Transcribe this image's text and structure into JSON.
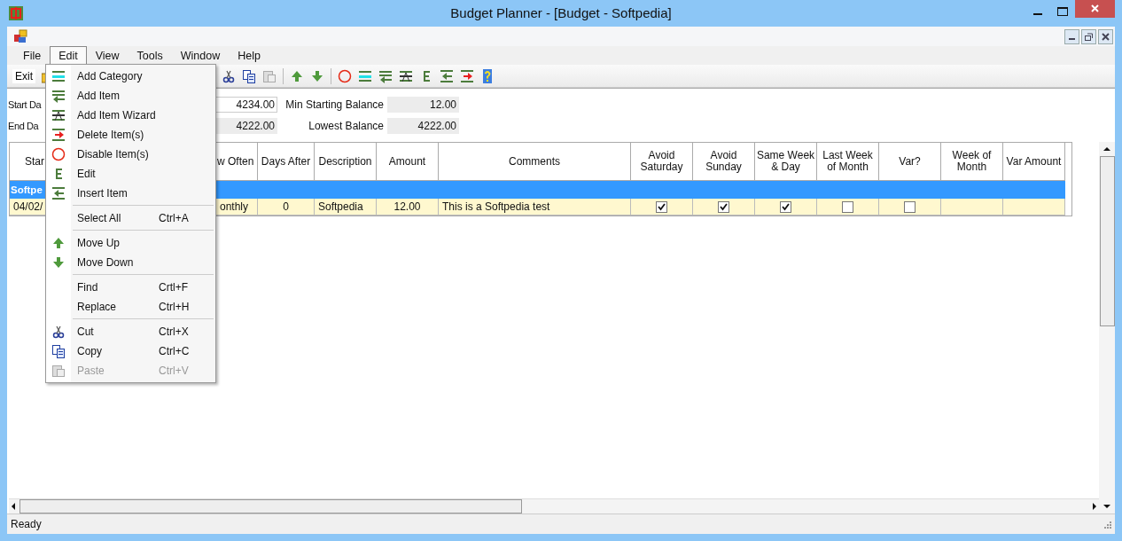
{
  "window": {
    "title": "Budget Planner - [Budget - Softpedia]"
  },
  "menubar": [
    {
      "label": "File",
      "selected": false
    },
    {
      "label": "Edit",
      "selected": true
    },
    {
      "label": "View",
      "selected": false
    },
    {
      "label": "Tools",
      "selected": false
    },
    {
      "label": "Window",
      "selected": false
    },
    {
      "label": "Help",
      "selected": false
    }
  ],
  "toolbar": {
    "exit": "Exit"
  },
  "summary": [
    {
      "label": "Start Da",
      "value": "4234.00",
      "editable": true,
      "label2": "Min Starting Balance",
      "value2": "12.00"
    },
    {
      "label": "End Da",
      "value": "4222.00",
      "editable": false,
      "label2": "Lowest Balance",
      "value2": "4222.00"
    }
  ],
  "grid": {
    "columns": [
      "Star",
      "w Often",
      "Days After",
      "Description",
      "Amount",
      "Comments",
      "Avoid Saturday",
      "Avoid Sunday",
      "Same Week & Day",
      "Last Week of Month",
      "Var?",
      "Week of Month",
      "Var Amount"
    ],
    "category": "Softpe",
    "rows": [
      {
        "cells": [
          {
            "kind": "text",
            "text": "04/02/"
          },
          {
            "kind": "text",
            "text": "onthly"
          },
          {
            "kind": "text",
            "text": "0"
          },
          {
            "kind": "text",
            "text": "Softpedia"
          },
          {
            "kind": "text",
            "text": "12.00"
          },
          {
            "kind": "text",
            "text": "This is a Softpedia test"
          },
          {
            "kind": "check",
            "checked": true
          },
          {
            "kind": "check",
            "checked": true
          },
          {
            "kind": "check",
            "checked": true
          },
          {
            "kind": "check",
            "checked": false
          },
          {
            "kind": "check",
            "checked": false
          },
          {
            "kind": "blank"
          },
          {
            "kind": "blank"
          }
        ]
      }
    ]
  },
  "edit_menu": [
    {
      "kind": "item",
      "label": "Add Category",
      "disabled": false
    },
    {
      "kind": "item",
      "label": "Add Item",
      "disabled": false
    },
    {
      "kind": "item",
      "label": "Add Item Wizard",
      "disabled": false
    },
    {
      "kind": "item",
      "label": "Delete Item(s)",
      "disabled": false
    },
    {
      "kind": "item",
      "label": "Disable Item(s)",
      "disabled": false
    },
    {
      "kind": "item",
      "label": "Edit",
      "disabled": false
    },
    {
      "kind": "item",
      "label": "Insert Item",
      "disabled": false
    },
    {
      "kind": "separator"
    },
    {
      "kind": "item",
      "label": "Select All",
      "shortcut": "Ctrl+A",
      "disabled": false
    },
    {
      "kind": "separator"
    },
    {
      "kind": "item",
      "label": "Move Up",
      "disabled": false
    },
    {
      "kind": "item",
      "label": "Move Down",
      "disabled": false
    },
    {
      "kind": "separator"
    },
    {
      "kind": "item",
      "label": "Find",
      "shortcut": "Crtl+F",
      "disabled": false
    },
    {
      "kind": "item",
      "label": "Replace",
      "shortcut": "Ctrl+H",
      "disabled": false
    },
    {
      "kind": "separator"
    },
    {
      "kind": "item",
      "label": "Cut",
      "shortcut": "Ctrl+X",
      "disabled": false
    },
    {
      "kind": "item",
      "label": "Copy",
      "shortcut": "Ctrl+C",
      "disabled": false
    },
    {
      "kind": "item",
      "label": "Paste",
      "shortcut": "Ctrl+V",
      "disabled": true
    }
  ],
  "status_bar": {
    "text": "Ready"
  }
}
